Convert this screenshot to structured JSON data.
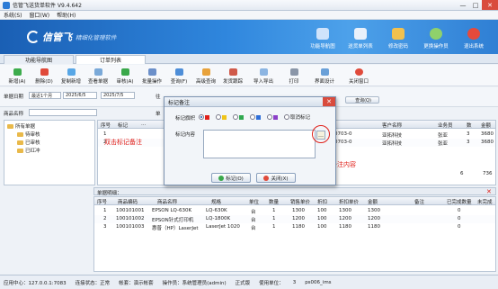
{
  "window": {
    "title": "信管飞送货单软件 V9.4.642",
    "min": "—",
    "max": "□",
    "close": "✕"
  },
  "menu": [
    "系统(S)",
    "窗口(W)",
    "帮助(H)"
  ],
  "banner": {
    "logo": "信管飞",
    "slogan": "精细化管理软件",
    "buttons": [
      "功能导航图",
      "送货单列表",
      "修改密码",
      "更换操作员",
      "退出系统"
    ]
  },
  "tabs": [
    "功能导航图",
    "订单列表"
  ],
  "toolbar": [
    "新增(A)",
    "删除(D)",
    "复制新增",
    "查看单据",
    "审核(A)",
    "批量操作",
    "查询(F)",
    "高级查询",
    "发货跟踪",
    "导入导出",
    "打印",
    "界面设计",
    "关闭窗口"
  ],
  "filter": {
    "date_label": "单据日期",
    "date_range": "最近1个月",
    "date_from": "2025/6/5",
    "date_to": "2025/7/5",
    "product_label": "商品名称",
    "query_btn": "查询(Q)",
    "org_short": "往",
    "unit_short": "单"
  },
  "tree": [
    "所有单据",
    "待审核",
    "已审核",
    "已红冲"
  ],
  "grid_top": {
    "headers": [
      "序号",
      "标记",
      "...",
      "客户名称",
      "业务员",
      "数",
      "金额"
    ],
    "rows": [
      [
        "1",
        "",
        "250703-0",
        "亚拓科技",
        "张亚",
        "3",
        "3680"
      ],
      [
        "2",
        "",
        "250703-0",
        "亚拓科技",
        "张亚",
        "3",
        "3680"
      ]
    ],
    "total_qty": "6",
    "total_amt": "736"
  },
  "detail": {
    "title": "单据明细：",
    "headers": [
      "序号",
      "商品编码",
      "商品名称",
      "规格",
      "单位",
      "数量",
      "销售单价",
      "折扣",
      "折扣单价",
      "金额",
      "备注",
      "已完成数量",
      "未完成"
    ],
    "rows": [
      [
        "1",
        "100101001",
        "EPSON LQ-630K",
        "LQ-630K",
        "台",
        "1",
        "1300",
        "100",
        "1300",
        "1300",
        "",
        "0",
        ""
      ],
      [
        "2",
        "100101002",
        "EPSON针式打印机",
        "LQ-1800K",
        "台",
        "1",
        "1200",
        "100",
        "1200",
        "1200",
        "",
        "0",
        ""
      ],
      [
        "3",
        "100101003",
        "惠普（HP）LaserJet",
        "LaserJet 1020",
        "台",
        "1",
        "1180",
        "100",
        "1180",
        "1180",
        "",
        "0",
        ""
      ]
    ]
  },
  "status": {
    "server": "应用中心：127.0.0.1:7083",
    "conn": "连接状态：正常",
    "account": "帐套：演示帐套",
    "operator": "操作员：系统管理员(admin)",
    "edition": "正式版",
    "user": "使用单位：",
    "code": "ps006_ims",
    "page": "3"
  },
  "dialog": {
    "title": "标记备注",
    "flag_label": "标记旗帜",
    "flag_clear": "取消标记",
    "memo_label": "标记内容",
    "memo_value": "",
    "memo_btn": "…",
    "ok": "标记(O)",
    "close": "关闭(X)"
  },
  "annotations": {
    "left": "双击标记备注",
    "right": "点击维护标记备注内容"
  },
  "colors": {
    "accent": "#1a5fb4",
    "flag_red": "#e0201a",
    "flag_yellow": "#f0c419",
    "flag_green": "#2fa84f",
    "flag_blue": "#2f6fd8",
    "flag_purple": "#8b3fc8"
  }
}
